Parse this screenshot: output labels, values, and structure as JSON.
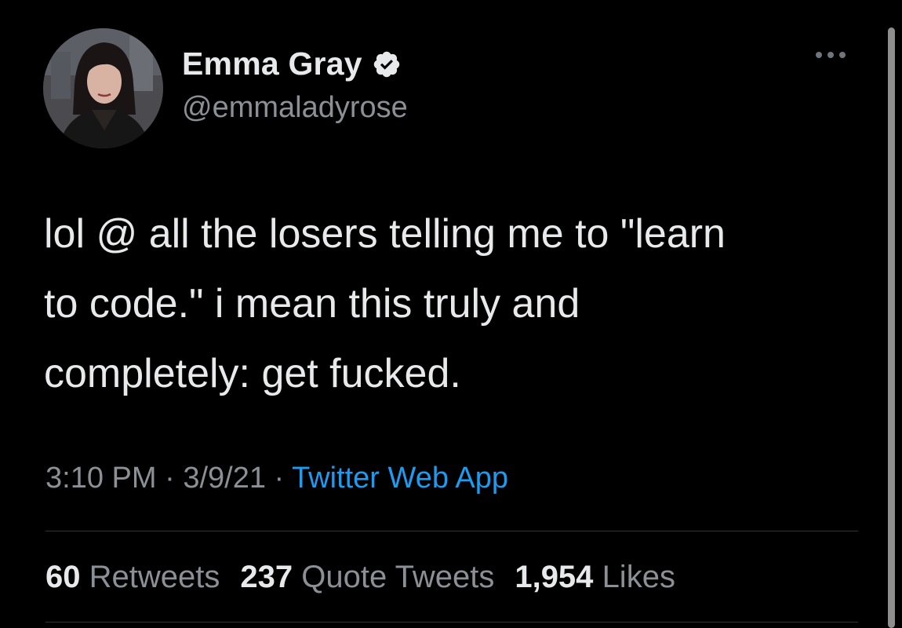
{
  "author": {
    "display_name": "Emma Gray",
    "handle": "@emmaladyrose",
    "verified_icon": "verified-badge-icon"
  },
  "tweet": {
    "text_lines": [
      "lol @ all the losers telling me to \"learn",
      "to code.\" i mean this truly and",
      "completely: get fucked."
    ]
  },
  "meta": {
    "time": "3:10 PM",
    "separator": " · ",
    "date": "3/9/21",
    "source": "Twitter Web App"
  },
  "stats": {
    "retweets_count": "60",
    "retweets_label": "Retweets",
    "quotes_count": "237",
    "quotes_label": "Quote Tweets",
    "likes_count": "1,954",
    "likes_label": "Likes"
  },
  "colors": {
    "background": "#000000",
    "text": "#e7e9ea",
    "secondary_text": "#8b9096",
    "link": "#1d9bf0",
    "divider": "#2f3336"
  }
}
